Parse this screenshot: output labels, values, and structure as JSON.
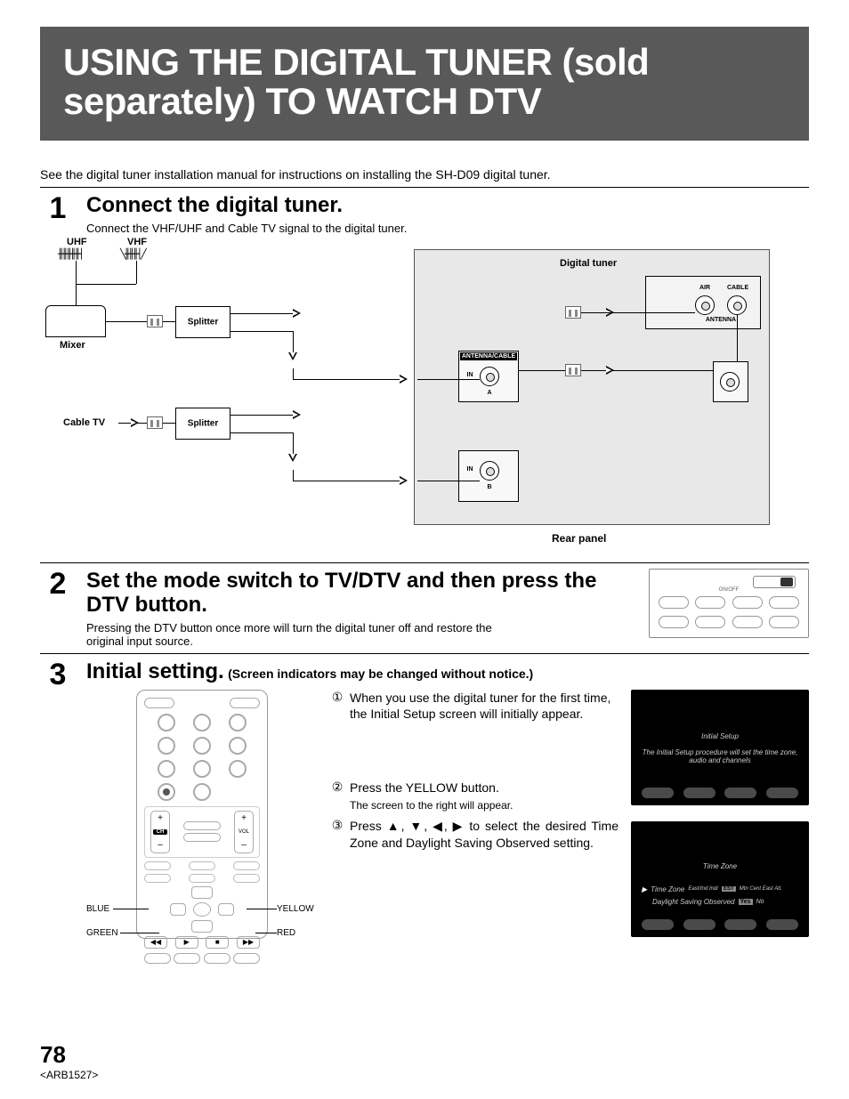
{
  "title": "USING THE DIGITAL TUNER (sold separately) TO WATCH DTV",
  "intro": "See the digital tuner installation manual for instructions on installing the SH-D09 digital tuner.",
  "step1": {
    "num": "1",
    "heading": "Connect the digital tuner.",
    "sub": "Connect the VHF/UHF and Cable TV signal to the digital tuner.",
    "labels": {
      "uhf": "UHF",
      "vhf": "VHF",
      "mixer": "Mixer",
      "splitter": "Splitter",
      "cabletv": "Cable TV",
      "digital_tuner": "Digital tuner",
      "rear_panel": "Rear panel",
      "ant_cable": "ANTENNA/CABLE",
      "conn_a": "A",
      "conn_b": "B",
      "air": "AIR",
      "cable": "CABLE",
      "in": "IN",
      "antenna": "ANTENNA"
    }
  },
  "step2": {
    "num": "2",
    "heading": "Set the mode switch to TV/DTV and then press the DTV button.",
    "sub": "Pressing the DTV button once more will turn the digital tuner off and restore the original input source.",
    "remote": {
      "mid": "ON/OFF"
    }
  },
  "step3": {
    "num": "3",
    "heading": "Initial setting.",
    "note": "(Screen indicators may be changed without notice.)",
    "items": [
      {
        "n": "①",
        "text": "When you use the digital tuner for the first time, the Initial Setup screen will initially appear."
      },
      {
        "n": "②",
        "text": "Press the YELLOW button.",
        "sub": "The screen to the right will appear."
      },
      {
        "n": "③",
        "text": "Press ▲, ▼, ◀, ▶ to select the desired Time Zone and Daylight Saving Observed setting."
      }
    ],
    "remote_labels": {
      "blue": "BLUE",
      "green": "GREEN",
      "yellow": "YELLOW",
      "red": "RED",
      "ch": "CH",
      "vol": "VOL",
      "plus": "+",
      "minus": "–"
    },
    "screens": {
      "a": {
        "title": "Initial Setup",
        "sub": "The Initial Setup procedure will set the time zone, audio and channels"
      },
      "b": {
        "title": "Time Zone",
        "row1_prefix": "Time Zone",
        "row1_opts": "East/Ind   Ind/",
        "row1_hl": "EST",
        "row1_rest": "Mtn  Cent  East  Atl.",
        "row2": "Daylight Saving Observed",
        "row2_hl": "Yes",
        "row2_rest": "No"
      }
    }
  },
  "footer": {
    "page": "78",
    "docid": "<ARB1527>"
  }
}
